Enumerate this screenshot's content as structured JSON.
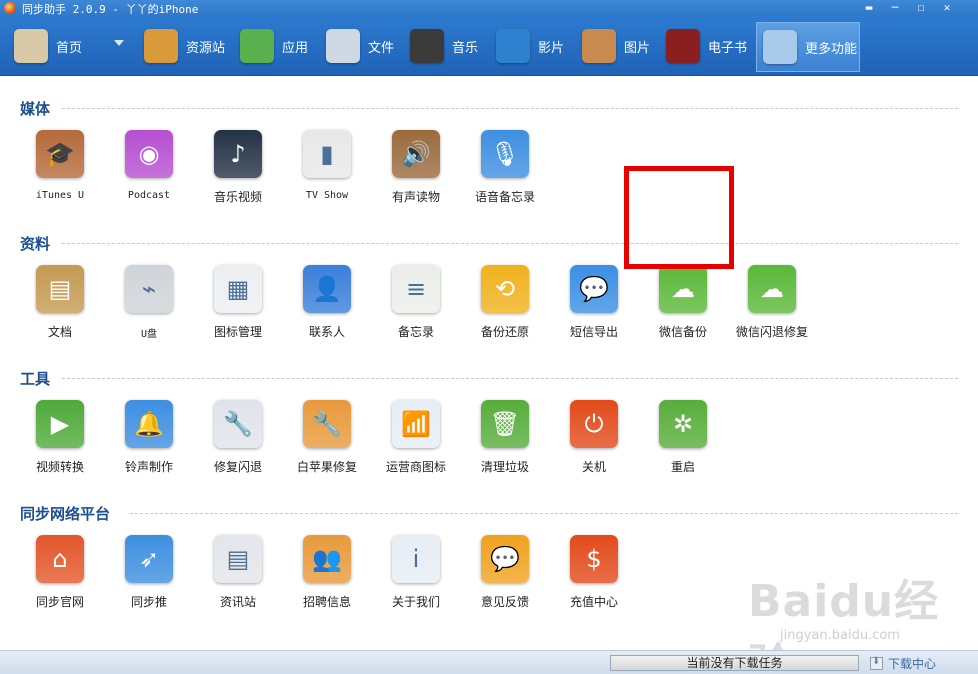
{
  "window": {
    "title": "同步助手 2.0.9 - 丫丫的iPhone",
    "controls": [
      "▬",
      "─",
      "☐",
      "✕"
    ]
  },
  "toolbar": {
    "items": [
      {
        "label": "首页",
        "icon": "home-icon",
        "color": "#d9c9a7"
      },
      {
        "label": "资源站",
        "icon": "shopping-bag-icon",
        "color": "#d99a3a"
      },
      {
        "label": "应用",
        "icon": "apps-icon",
        "color": "#5ab04c"
      },
      {
        "label": "文件",
        "icon": "folder-icon",
        "color": "#cfd8e3"
      },
      {
        "label": "音乐",
        "icon": "music-icon",
        "color": "#3a3a3a"
      },
      {
        "label": "影片",
        "icon": "video-icon",
        "color": "#2d82d0"
      },
      {
        "label": "图片",
        "icon": "photo-icon",
        "color": "#c98a4f"
      },
      {
        "label": "电子书",
        "icon": "book-icon",
        "color": "#8b1f1f"
      },
      {
        "label": "更多功能",
        "icon": "tools-icon",
        "color": "#a9c9ea"
      }
    ]
  },
  "sections": [
    {
      "title": "媒体",
      "items": [
        {
          "label": "iTunes U",
          "icon": "graduation-cap-icon",
          "color": "#b56a3a",
          "glyph": "🎓"
        },
        {
          "label": "Podcast",
          "icon": "podcast-icon",
          "color": "#b64fd1",
          "glyph": "◉"
        },
        {
          "label": "音乐视频",
          "icon": "music-video-icon",
          "color": "#243246",
          "glyph": "♪"
        },
        {
          "label": "TV Show",
          "icon": "tv-icon",
          "color": "#e8e8e8",
          "glyph": "▮"
        },
        {
          "label": "有声读物",
          "icon": "audiobook-icon",
          "color": "#9b6a3c",
          "glyph": "🔊"
        },
        {
          "label": "语音备忘录",
          "icon": "microphone-icon",
          "color": "#3d8fe0",
          "glyph": "🎙"
        }
      ]
    },
    {
      "title": "资料",
      "items": [
        {
          "label": "文档",
          "icon": "document-icon",
          "color": "#c49a52",
          "glyph": "▤"
        },
        {
          "label": "U盘",
          "icon": "usb-drive-icon",
          "color": "#cfd4d8",
          "glyph": "⌁"
        },
        {
          "label": "图标管理",
          "icon": "icon-grid-icon",
          "color": "#eceff2",
          "glyph": "▦"
        },
        {
          "label": "联系人",
          "icon": "contacts-icon",
          "color": "#3a7fd9",
          "glyph": "👤"
        },
        {
          "label": "备忘录",
          "icon": "notes-icon",
          "color": "#eaeee8",
          "glyph": "≡"
        },
        {
          "label": "备份还原",
          "icon": "backup-icon",
          "color": "#f0b21e",
          "glyph": "⟲"
        },
        {
          "label": "短信导出",
          "icon": "sms-icon",
          "color": "#3b8fe4",
          "glyph": "💬"
        },
        {
          "label": "微信备份",
          "icon": "wechat-icon",
          "color": "#5cb839",
          "glyph": "☁"
        },
        {
          "label": "微信闪退修复",
          "icon": "wechat-repair-icon",
          "color": "#5cb839",
          "glyph": "☁"
        }
      ]
    },
    {
      "title": "工具",
      "items": [
        {
          "label": "视频转换",
          "icon": "video-convert-icon",
          "color": "#4faa3a",
          "glyph": "▶"
        },
        {
          "label": "铃声制作",
          "icon": "bell-icon",
          "color": "#3d8fe0",
          "glyph": "🔔"
        },
        {
          "label": "修复闪退",
          "icon": "wrench-icon",
          "color": "#e0e4ea",
          "glyph": "🔧"
        },
        {
          "label": "白苹果修复",
          "icon": "repair-icon",
          "color": "#e89a3c",
          "glyph": "🔧"
        },
        {
          "label": "运营商图标",
          "icon": "carrier-icon",
          "color": "#e6edf4",
          "glyph": "📶"
        },
        {
          "label": "清理垃圾",
          "icon": "trash-icon",
          "color": "#57ad3a",
          "glyph": "🗑"
        },
        {
          "label": "关机",
          "icon": "power-icon",
          "color": "#e24a1a",
          "glyph": "⏻"
        },
        {
          "label": "重启",
          "icon": "restart-icon",
          "color": "#57ad3a",
          "glyph": "✲"
        }
      ]
    },
    {
      "title": "同步网络平台",
      "items": [
        {
          "label": "同步官网",
          "icon": "home-page-icon",
          "color": "#e2572a",
          "glyph": "⌂"
        },
        {
          "label": "同步推",
          "icon": "tongbu-push-icon",
          "color": "#3d8fe0",
          "glyph": "➶"
        },
        {
          "label": "资讯站",
          "icon": "news-icon",
          "color": "#e3e6ea",
          "glyph": "▤"
        },
        {
          "label": "招聘信息",
          "icon": "recruit-icon",
          "color": "#e89a3c",
          "glyph": "👥"
        },
        {
          "label": "关于我们",
          "icon": "info-icon",
          "color": "#e6edf4",
          "glyph": "i"
        },
        {
          "label": "意见反馈",
          "icon": "feedback-icon",
          "color": "#f0a21e",
          "glyph": "💬"
        },
        {
          "label": "充值中心",
          "icon": "dollar-icon",
          "color": "#e24a1a",
          "glyph": "$"
        }
      ]
    }
  ],
  "status": {
    "download_status": "当前没有下载任务",
    "download_center": "下载中心"
  },
  "watermark": {
    "brand": "Baidu经验",
    "url": "jingyan.baidu.com"
  }
}
